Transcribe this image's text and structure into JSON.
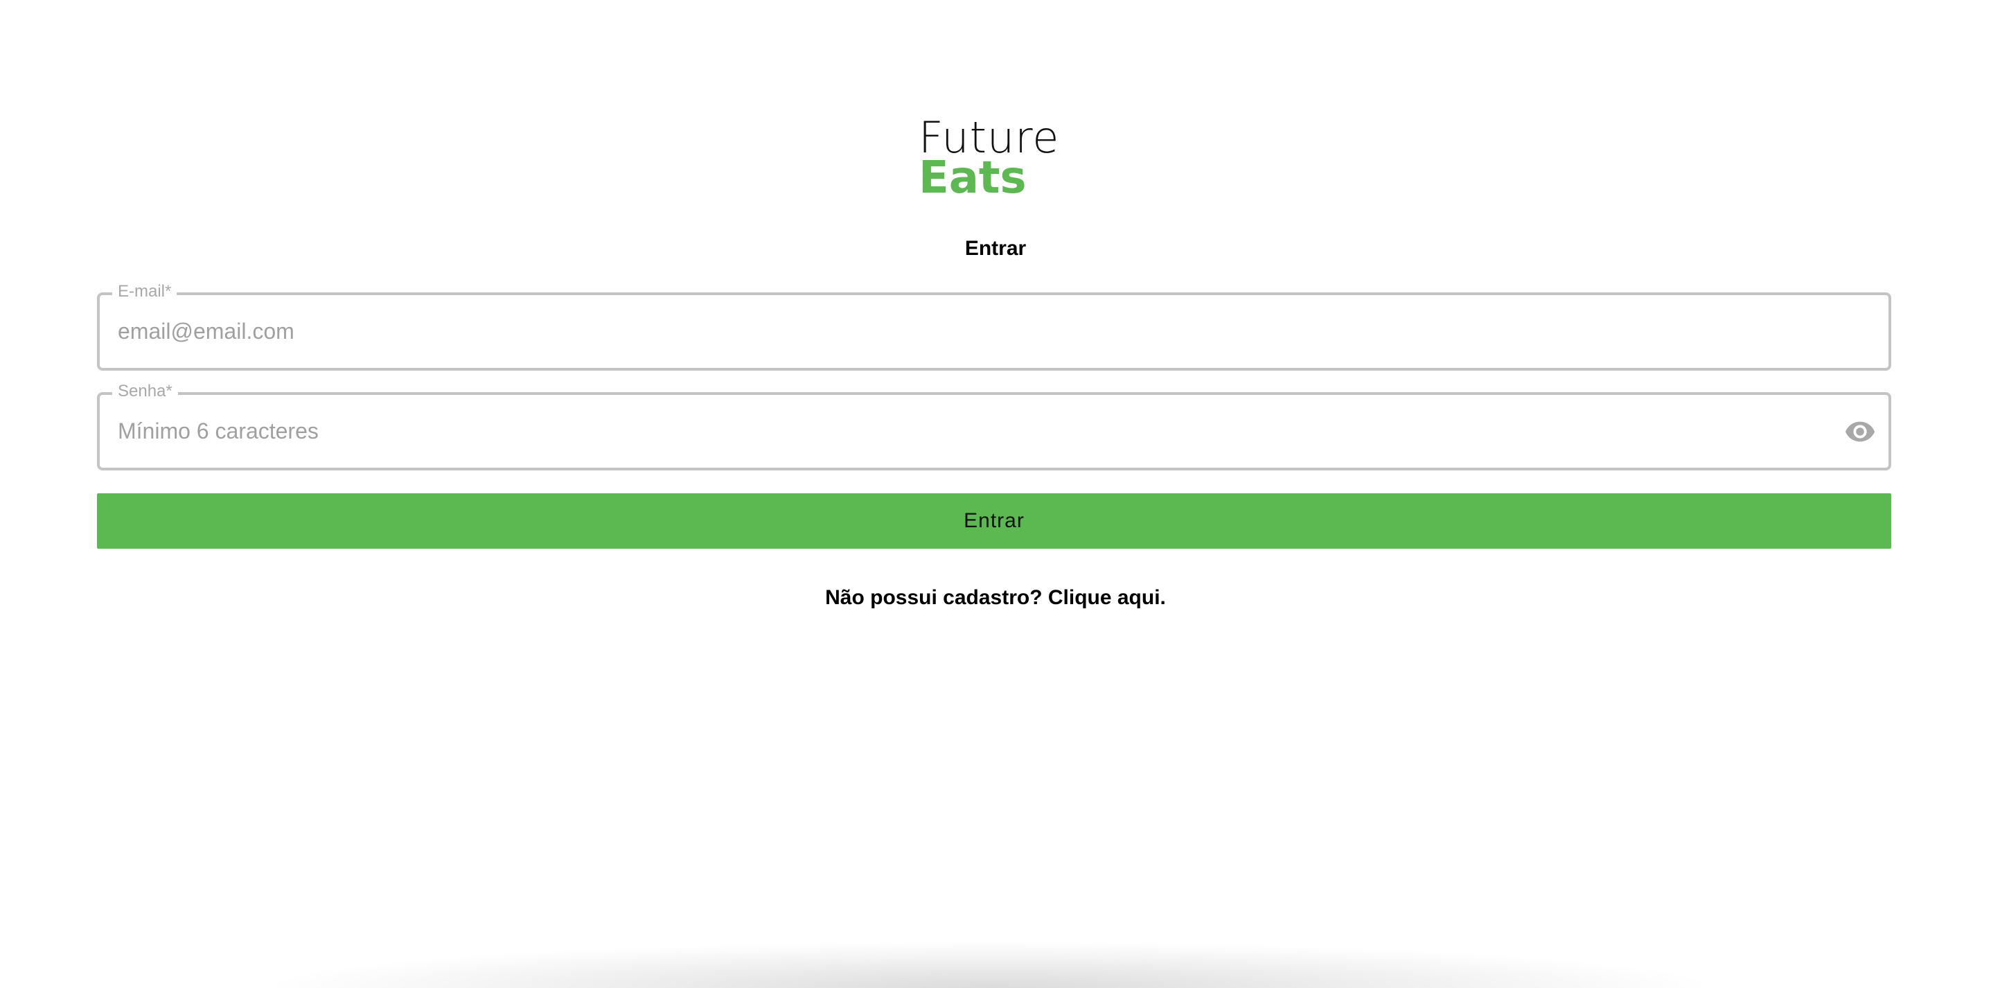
{
  "logo": {
    "line1": "Future",
    "line2": "Eats"
  },
  "form": {
    "title": "Entrar",
    "email": {
      "label": "E-mail*",
      "placeholder": "email@email.com",
      "value": ""
    },
    "password": {
      "label": "Senha*",
      "placeholder": "Mínimo 6 caracteres",
      "value": "",
      "toggle_icon": "eye-icon"
    },
    "submit_label": "Entrar",
    "signup_text": "Não possui cadastro? Clique aqui."
  },
  "colors": {
    "brand_green": "#5cb851",
    "field_border": "#c4c4c4",
    "placeholder": "#a0a0a0"
  }
}
